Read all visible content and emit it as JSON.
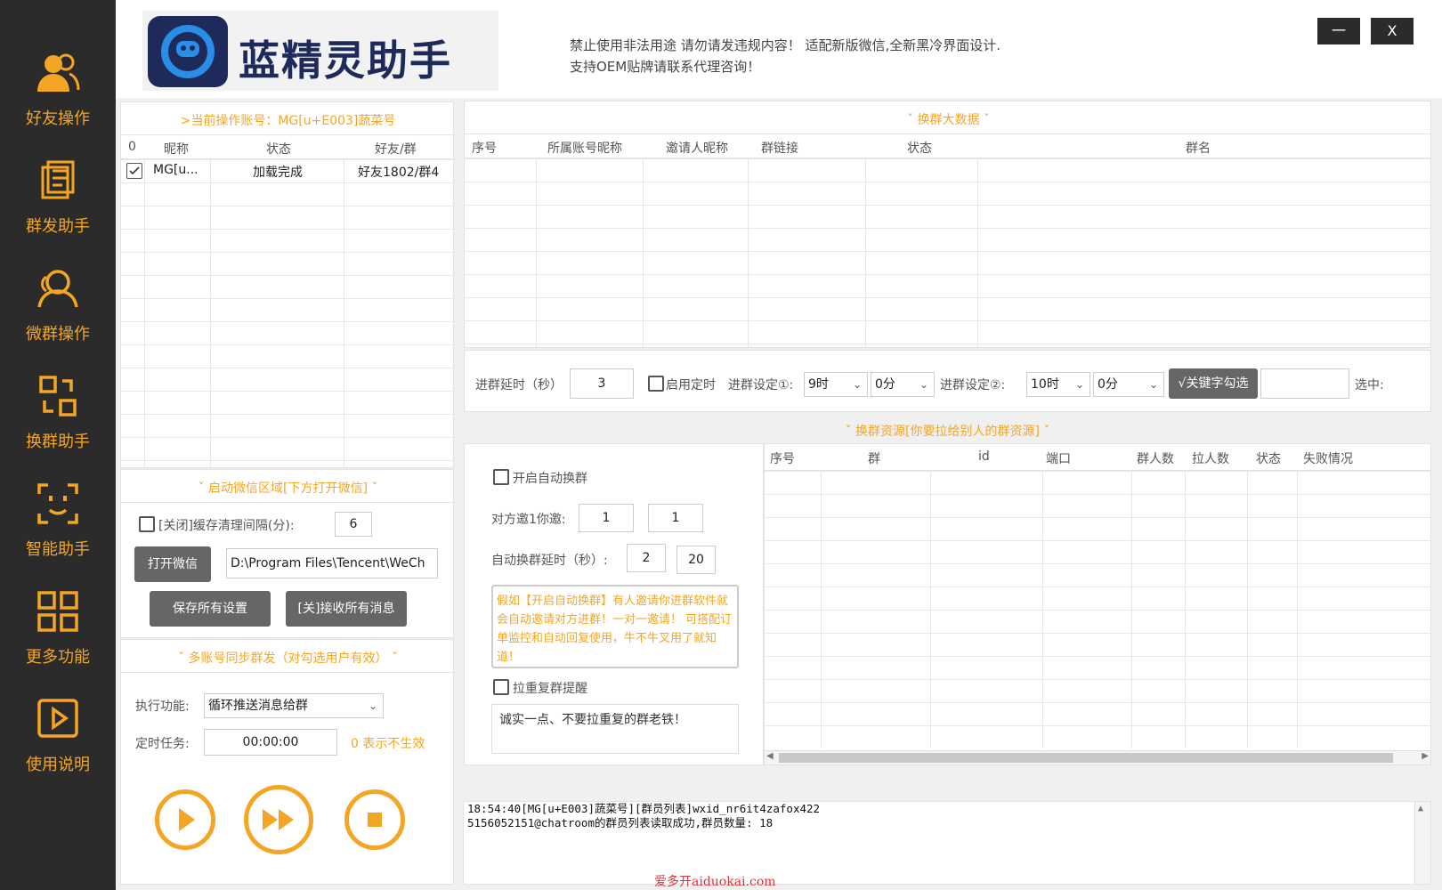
{
  "sidebar": {
    "items": [
      {
        "label": "好友操作",
        "icon": "users-icon"
      },
      {
        "label": "群发助手",
        "icon": "mass-send-icon"
      },
      {
        "label": "微群操作",
        "icon": "group-icon"
      },
      {
        "label": "换群助手",
        "icon": "swap-icon"
      },
      {
        "label": "智能助手",
        "icon": "smart-face-icon"
      },
      {
        "label": "更多功能",
        "icon": "grid-icon"
      },
      {
        "label": "使用说明",
        "icon": "play-doc-icon"
      }
    ]
  },
  "header": {
    "app_name": "蓝精灵助手",
    "notice_line1": "禁止使用非法用途 请勿请发违规内容！ 适配新版微信,全新黑冷界面设计.",
    "notice_line2": "支持OEM贴牌请联系代理咨询！",
    "minimize": "一",
    "close": "X"
  },
  "account_panel": {
    "title": ">当前操作账号：MG[u+E003]蔬菜号",
    "columns": [
      "0",
      "昵称",
      "状态",
      "好友/群"
    ],
    "rows": [
      {
        "nickname": "MG[u...",
        "status": "加载完成",
        "stats": "好友1802/群4"
      }
    ]
  },
  "wechat_panel": {
    "title": "ˇ 启动微信区域[下方打开微信] ˇ",
    "cache_label": "[关闭]缓存清理间隔(分):",
    "cache_value": "6",
    "open_button": "打开微信",
    "path_value": "D:\\Program Files\\Tencent\\WeCh",
    "save_button": "保存所有设置",
    "receive_button": "[关]接收所有消息"
  },
  "sync_panel": {
    "title": "ˇ 多账号同步群发（对勾选用户有效） ˇ",
    "exec_label": "执行功能:",
    "exec_value": "循环推送消息给群",
    "timer_label": "定时任务:",
    "timer_value": "00:00:00",
    "timer_hint": "0 表示不生效"
  },
  "swap_data": {
    "title": "ˇ 换群大数据 ˇ",
    "columns": [
      "序号",
      "所属账号昵称",
      "邀请人昵称",
      "群链接",
      "状态",
      "群名"
    ]
  },
  "join_settings": {
    "delay_label": "进群延时（秒）",
    "delay_value": "3",
    "timer_label": "启用定时",
    "set1_label": "进群设定①:",
    "set1_hour": "9时",
    "set1_min": "0分",
    "set2_label": "进群设定②:",
    "set2_hour": "10时",
    "set2_min": "0分",
    "keyword_button": "√关键字勾选",
    "selected_label": "选中:"
  },
  "swap_resource": {
    "title": "ˇ 换群资源[你要拉给别人的群资源] ˇ",
    "auto_label": "开启自动换群",
    "invite_label": "对方邀1你邀:",
    "invite_a": "1",
    "invite_b": "1",
    "auto_delay_label": "自动换群延时（秒）:",
    "auto_delay_a": "2",
    "auto_delay_b": "20",
    "info_text": "假如【开启自动换群】有人邀请你进群软件就会自动邀请对方进群！一对一邀请！ 可搭配订单监控和自动回复使用，牛不牛叉用了就知道！",
    "dup_label": "拉重复群提醒",
    "dup_text": "诚实一点、不要拉重复的群老铁！",
    "columns": [
      "序号",
      "群",
      "id",
      "端口",
      "群人数",
      "拉人数",
      "状态",
      "失败情况"
    ]
  },
  "log": {
    "line1": "18:54:40[MG[u+E003]蔬菜号][群员列表]wxid_nr6it4zafox422",
    "line2": "5156052151@chatroom的群员列表读取成功,群员数量: 18"
  },
  "watermark": "爱多开aiduokai.com",
  "colors": {
    "accent": "#f5a524",
    "sidebar": "#2b2b2b",
    "brand": "#1e2a5a"
  }
}
